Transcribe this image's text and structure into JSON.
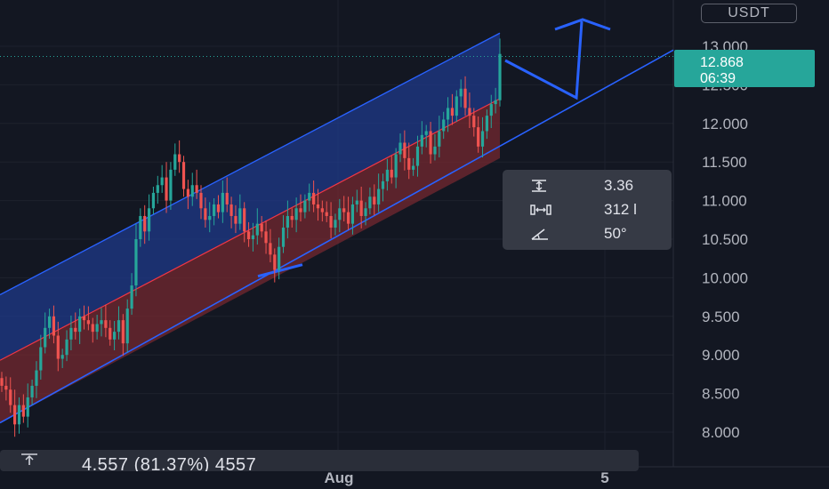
{
  "chart_data": {
    "type": "candlestick",
    "y_axis": {
      "ticks": [
        "13.000",
        "12.500",
        "12.000",
        "11.500",
        "11.000",
        "10.500",
        "10.000",
        "9.500",
        "9.000",
        "8.500",
        "8.000"
      ],
      "range": [
        7.7,
        13.5
      ]
    },
    "x_axis": {
      "ticks": [
        "Aug",
        "5"
      ]
    },
    "currency": "USDT",
    "last_price": {
      "value": 12.868,
      "text": "12.868",
      "countdown": "06:39",
      "color": "#26a69a"
    },
    "candles_close": [
      8.6,
      8.55,
      8.35,
      8.1,
      8.35,
      8.2,
      8.45,
      8.6,
      8.8,
      9.1,
      9.35,
      9.5,
      9.25,
      8.95,
      9.0,
      9.2,
      9.35,
      9.3,
      9.5,
      9.45,
      9.4,
      9.3,
      9.4,
      9.45,
      9.35,
      9.2,
      9.3,
      9.45,
      9.15,
      9.6,
      9.9,
      10.5,
      10.8,
      10.6,
      10.9,
      11.1,
      11.2,
      11.3,
      11.0,
      11.4,
      11.6,
      11.5,
      11.15,
      11.05,
      11.2,
      11.1,
      10.9,
      10.75,
      10.8,
      10.95,
      10.85,
      11.1,
      10.95,
      10.8,
      10.7,
      10.9,
      10.6,
      10.5,
      10.55,
      10.7,
      10.6,
      10.45,
      10.3,
      10.1,
      10.4,
      10.65,
      10.8,
      10.75,
      10.9,
      10.85,
      11.0,
      11.1,
      10.95,
      10.9,
      10.85,
      10.8,
      10.65,
      10.75,
      10.9,
      10.85,
      10.7,
      10.95,
      11.0,
      10.8,
      10.9,
      11.05,
      10.95,
      11.15,
      11.25,
      11.4,
      11.3,
      11.6,
      11.75,
      11.55,
      11.4,
      11.45,
      11.7,
      11.85,
      11.9,
      11.6,
      11.7,
      11.9,
      12.05,
      12.2,
      12.1,
      12.35,
      12.45,
      12.2,
      12.1,
      11.95,
      11.7,
      11.9,
      12.1,
      12.25,
      12.3,
      12.9
    ],
    "channel": {
      "upper_band_color": "#2962ff",
      "lower_band_color": "#f23645",
      "line_color": "#2962ff",
      "angle": "50°"
    },
    "bullish_color": "#26a69a",
    "bearish_color": "#ef5350"
  },
  "measure_panel": {
    "height_icon": "vertical-range-icon",
    "height_value": "3.36",
    "bars_icon": "bars-range-icon",
    "bars_value": "312 l",
    "angle_icon": "angle-icon",
    "angle_value": "50°"
  },
  "bottom_bar": {
    "icon": "vertical-range-icon",
    "text": "4.557 (81.37%) 4557"
  }
}
